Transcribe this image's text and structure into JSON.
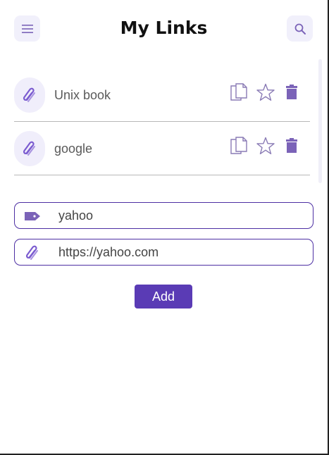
{
  "header": {
    "title": "My Links",
    "menu_icon": "hamburger-menu-icon",
    "search_icon": "search-icon"
  },
  "links": [
    {
      "label": "Unix book",
      "icon": "paperclip-icon",
      "actions": [
        "copy-icon",
        "star-icon",
        "trash-icon"
      ]
    },
    {
      "label": "google",
      "icon": "paperclip-icon",
      "actions": [
        "copy-icon",
        "star-icon",
        "trash-icon"
      ]
    }
  ],
  "form": {
    "name_value": "yahoo",
    "name_icon": "tag-icon",
    "url_value": "https://yahoo.com",
    "url_icon": "paperclip-icon",
    "add_label": "Add"
  },
  "colors": {
    "accent": "#5a3bb5",
    "icon_purple": "#7b63b8",
    "icon_bg": "#f1f0fb",
    "divider": "#b8b8b8"
  }
}
